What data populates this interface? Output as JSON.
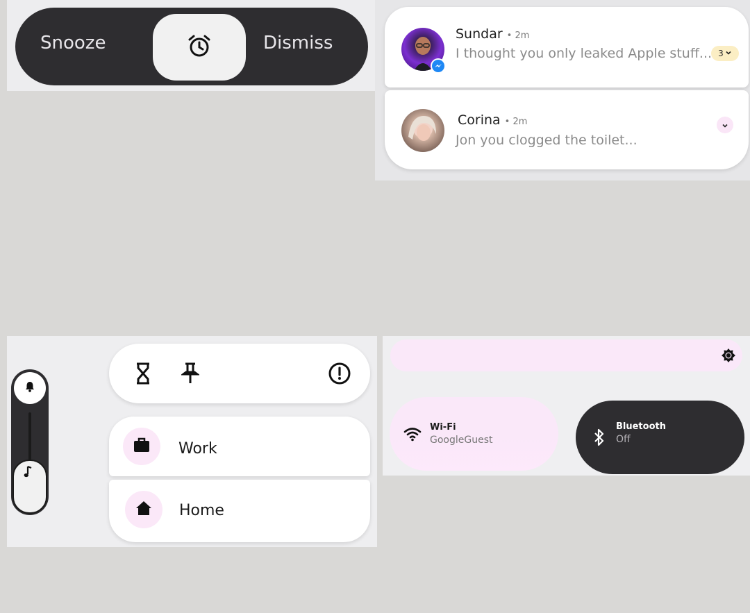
{
  "alarm": {
    "snooze_label": "Snooze",
    "dismiss_label": "Dismiss",
    "center_icon": "alarm-clock-icon"
  },
  "notifications": [
    {
      "name": "Sundar",
      "time": "• 2m",
      "message": "I thought you only leaked Apple stuff...",
      "count": "3",
      "badge_icon": "messenger-icon"
    },
    {
      "name": "Corina",
      "time": "• 2m",
      "message": "Jon you clogged the toilet..."
    }
  ],
  "volume": {
    "top_icon": "bell-icon",
    "thumb_icon": "music-note-icon"
  },
  "toolbar": {
    "icons": [
      "hourglass-icon",
      "pin-icon",
      "alert-circle-icon"
    ]
  },
  "modes": [
    {
      "label": "Work",
      "icon": "briefcase-icon"
    },
    {
      "label": "Home",
      "icon": "home-icon"
    }
  ],
  "quick_settings": {
    "brightness_icon": "brightness-icon",
    "wifi": {
      "title": "Wi-Fi",
      "subtitle": "GoogleGuest"
    },
    "bluetooth": {
      "title": "Bluetooth",
      "subtitle": "Off"
    }
  },
  "colors": {
    "dark": "#2e2d30",
    "pink_tint": "#fae8f9",
    "chip_yellow": "#fbeec4",
    "background": "#d9d8d6"
  }
}
